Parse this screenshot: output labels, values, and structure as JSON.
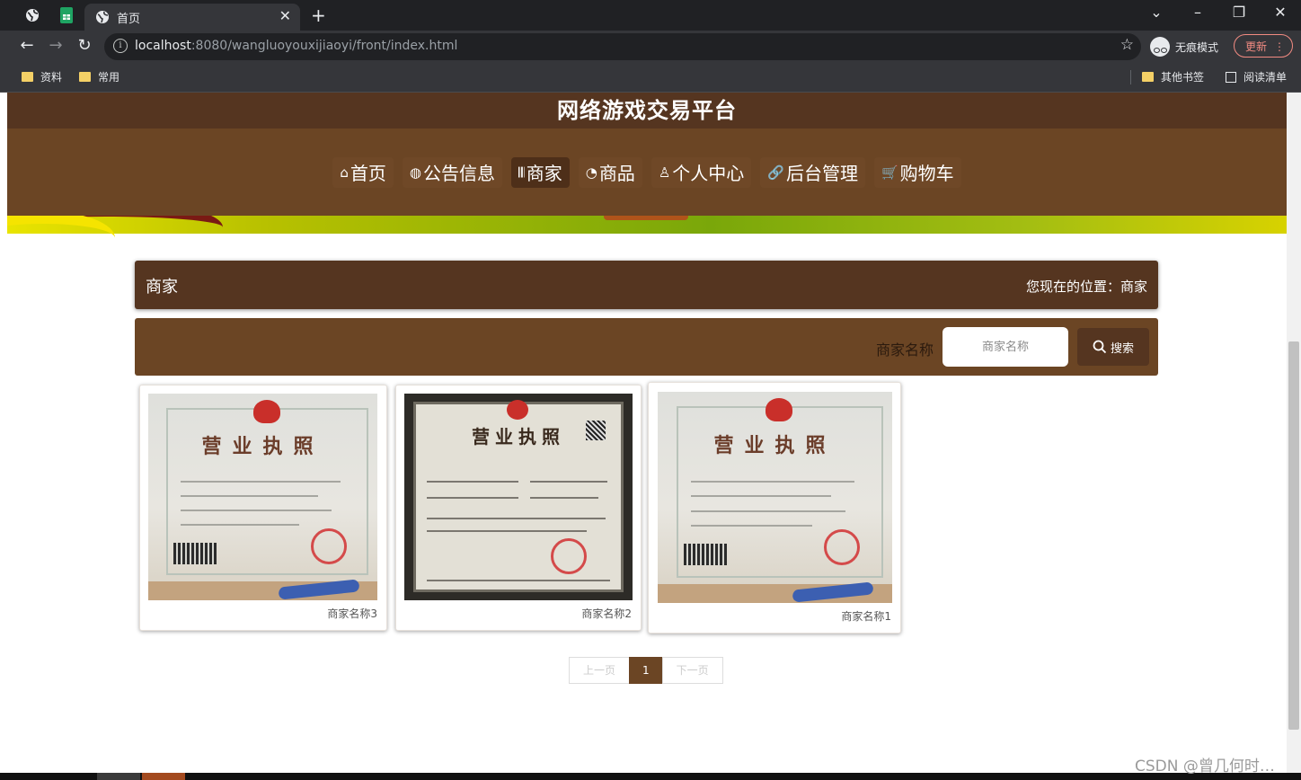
{
  "browser": {
    "active_tab_title": "首页",
    "url_host": "localhost",
    "url_rest": ":8080/wangluoyouxijiaoyi/front/index.html",
    "incognito_label": "无痕模式",
    "update_label": "更新",
    "bookmarks": [
      "资料",
      "常用"
    ],
    "other_bookmarks": "其他书签",
    "reading_list": "阅读清单"
  },
  "site": {
    "title": "网络游戏交易平台",
    "nav": [
      {
        "icon": "⌂",
        "label": "首页"
      },
      {
        "icon": "◍",
        "label": "公告信息"
      },
      {
        "icon": "𝄃𝄃",
        "label": "商家"
      },
      {
        "icon": "◔",
        "label": "商品"
      },
      {
        "icon": "♙",
        "label": "个人中心"
      },
      {
        "icon": "🔗",
        "label": "后台管理"
      },
      {
        "icon": "🛒",
        "label": "购物车"
      }
    ],
    "active_nav": "商家"
  },
  "breadcrumb": {
    "title": "商家",
    "position": "您现在的位置：商家"
  },
  "search": {
    "label": "商家名称",
    "placeholder": "商家名称",
    "button": "搜索"
  },
  "cards": [
    {
      "name": "商家名称3",
      "image": "business-license-photo"
    },
    {
      "name": "商家名称2",
      "image": "business-license-framed"
    },
    {
      "name": "商家名称1",
      "image": "business-license-photo"
    }
  ],
  "license_text": "营业执照",
  "pager": {
    "prev": "上一页",
    "current": "1",
    "next": "下一页"
  },
  "watermark": "CSDN @曾几何时…",
  "colors": {
    "brand_dark": "#553520",
    "brand": "#6b4524",
    "chrome_dark": "#202124",
    "chrome": "#35363a"
  }
}
